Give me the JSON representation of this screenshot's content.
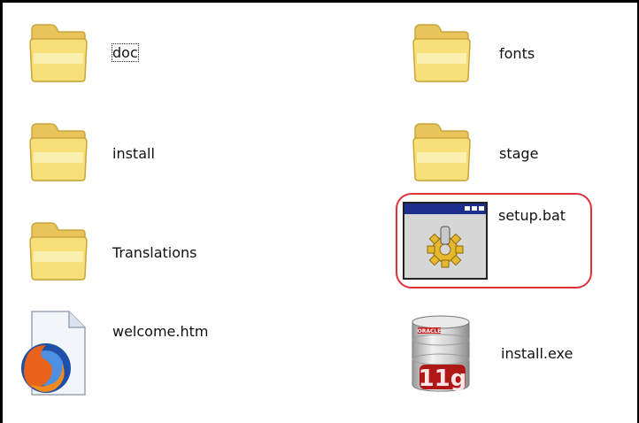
{
  "files": {
    "doc": {
      "name": "doc",
      "type": "folder",
      "focused": true
    },
    "fonts": {
      "name": "fonts",
      "type": "folder"
    },
    "install": {
      "name": "install",
      "type": "folder"
    },
    "stage": {
      "name": "stage",
      "type": "folder"
    },
    "translations": {
      "name": "Translations",
      "type": "folder"
    },
    "setup_bat": {
      "name": "setup.bat",
      "type": "batch-file",
      "highlighted": true
    },
    "welcome_htm": {
      "name": "welcome.htm",
      "type": "firefox-html-document"
    },
    "install_exe": {
      "name": "install.exe",
      "type": "oracle-installer",
      "badge_text": "11g",
      "brand_text": "ORACLE"
    }
  },
  "colors": {
    "highlight_ring": "#e0303a",
    "folder_fill": "#f7df7a",
    "folder_light": "#fdf3b8",
    "folder_edge": "#c9a63c"
  }
}
